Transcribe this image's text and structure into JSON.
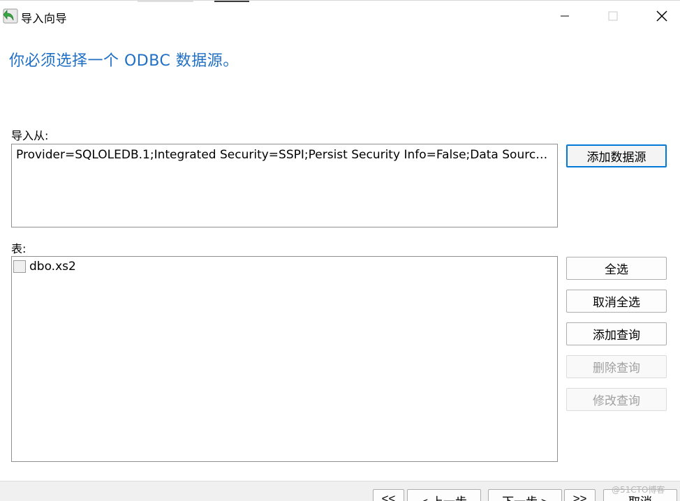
{
  "window": {
    "title": "导入向导",
    "controls": {
      "minimize": "minimize-icon",
      "maximize": "maximize-icon",
      "close": "close-icon"
    }
  },
  "header": {
    "text": "你必须选择一个 ODBC 数据源。"
  },
  "source": {
    "label": "导入从:",
    "value": "Provider=SQLOLEDB.1;Integrated Security=SSPI;Persist Security Info=False;Data Source=...",
    "add_button": "添加数据源"
  },
  "tables": {
    "label": "表:",
    "items": [
      {
        "name": "dbo.xs2",
        "checked": false
      }
    ]
  },
  "actions": {
    "select_all": "全选",
    "deselect_all": "取消全选",
    "add_query": "添加查询",
    "delete_query": "删除查询",
    "edit_query": "修改查询"
  },
  "nav": {
    "first": "<<",
    "prev": "< 上一步",
    "next": "下一步 >",
    "last": ">>",
    "cancel": "取消"
  },
  "watermark": "@51CTO博客",
  "colors": {
    "header": "#1f6fc5",
    "focus_border": "#0078d7"
  }
}
